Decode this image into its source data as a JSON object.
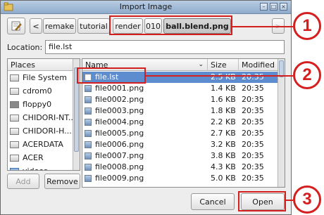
{
  "window": {
    "title": "Import Image",
    "buttons": [
      "minimize-icon",
      "maximize-icon",
      "close-icon"
    ]
  },
  "pathbar": {
    "toggle_icon": "edit-location-icon",
    "back_arrow": "<",
    "forward_arrow": ">",
    "crumbs": [
      "remake",
      "tutorial",
      "render",
      "010",
      "ball.blend.png"
    ]
  },
  "location": {
    "label": "Location:",
    "value": "file.lst"
  },
  "places": {
    "header": "Places",
    "items": [
      {
        "label": "File System",
        "icon": "drive-icon"
      },
      {
        "label": "cdrom0",
        "icon": "cdrom-icon"
      },
      {
        "label": "floppy0",
        "icon": "floppy-icon"
      },
      {
        "label": "CHIDORI-NT...",
        "icon": "drive-icon"
      },
      {
        "label": "CHIDORI-H...",
        "icon": "drive-icon"
      },
      {
        "label": "ACERDATA",
        "icon": "drive-icon"
      },
      {
        "label": "ACER",
        "icon": "drive-icon"
      },
      {
        "label": "videos",
        "icon": "folder-icon"
      }
    ],
    "add_label": "Add",
    "remove_label": "Remove"
  },
  "files": {
    "columns": [
      "Name",
      "Size",
      "Modified"
    ],
    "rows": [
      {
        "name": "file.lst",
        "size": "2.5 KB",
        "modified": "20:35",
        "selected": true
      },
      {
        "name": "file0001.png",
        "size": "1.4 KB",
        "modified": "20:35"
      },
      {
        "name": "file0002.png",
        "size": "1.6 KB",
        "modified": "20:35"
      },
      {
        "name": "file0003.png",
        "size": "1.8 KB",
        "modified": "20:35"
      },
      {
        "name": "file0004.png",
        "size": "2.2 KB",
        "modified": "20:35"
      },
      {
        "name": "file0005.png",
        "size": "2.7 KB",
        "modified": "20:35"
      },
      {
        "name": "file0006.png",
        "size": "3.2 KB",
        "modified": "20:35"
      },
      {
        "name": "file0007.png",
        "size": "3.8 KB",
        "modified": "20:35"
      },
      {
        "name": "file0008.png",
        "size": "4.3 KB",
        "modified": "20:35"
      },
      {
        "name": "file0009.png",
        "size": "5.0 KB",
        "modified": "20:35"
      }
    ]
  },
  "actions": {
    "cancel_label": "Cancel",
    "open_label": "Open"
  },
  "callouts": [
    "1",
    "2",
    "3"
  ],
  "colors": {
    "highlight": "#d41f1f",
    "selection": "#5d8ccf"
  }
}
